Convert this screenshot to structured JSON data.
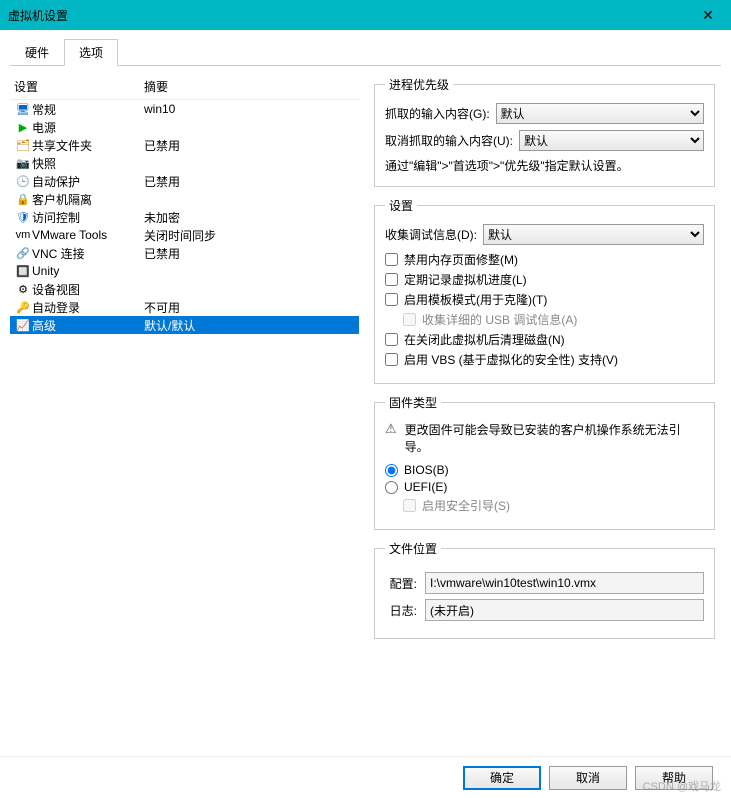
{
  "window": {
    "title": "虚拟机设置",
    "close": "✕"
  },
  "tabs": {
    "hardware": "硬件",
    "options": "选项"
  },
  "list": {
    "header": {
      "col1": "设置",
      "col2": "摘要"
    },
    "items": [
      {
        "icon": "🖥",
        "iconClass": "ico-blue",
        "name": "常规",
        "summary": "win10"
      },
      {
        "icon": "▶",
        "iconClass": "ico-green",
        "name": "电源",
        "summary": ""
      },
      {
        "icon": "🗂",
        "iconClass": "ico-orange",
        "name": "共享文件夹",
        "summary": "已禁用"
      },
      {
        "icon": "📷",
        "iconClass": "",
        "name": "快照",
        "summary": ""
      },
      {
        "icon": "🕒",
        "iconClass": "",
        "name": "自动保护",
        "summary": "已禁用"
      },
      {
        "icon": "🔒",
        "iconClass": "",
        "name": "客户机隔离",
        "summary": ""
      },
      {
        "icon": "🛡",
        "iconClass": "ico-blue",
        "name": "访问控制",
        "summary": "未加密"
      },
      {
        "icon": "vm",
        "iconClass": "",
        "name": "VMware Tools",
        "summary": "关闭时间同步"
      },
      {
        "icon": "🔗",
        "iconClass": "",
        "name": "VNC 连接",
        "summary": "已禁用"
      },
      {
        "icon": "🔲",
        "iconClass": "",
        "name": "Unity",
        "summary": ""
      },
      {
        "icon": "⚙",
        "iconClass": "",
        "name": "设备视图",
        "summary": ""
      },
      {
        "icon": "🔑",
        "iconClass": "",
        "name": "自动登录",
        "summary": "不可用"
      },
      {
        "icon": "📈",
        "iconClass": "ico-blue",
        "name": "高级",
        "summary": "默认/默认"
      }
    ],
    "selectedIndex": 12
  },
  "priority": {
    "legend": "进程优先级",
    "grabbed": "抓取的输入内容(G):",
    "ungrabbed": "取消抓取的输入内容(U):",
    "default": "默认",
    "note": "通过\"编辑\">\"首选项\">\"优先级\"指定默认设置。"
  },
  "settings": {
    "legend": "设置",
    "debug_label": "收集调试信息(D):",
    "debug_default": "默认",
    "chk_mem": "禁用内存页面修整(M)",
    "chk_log": "定期记录虚拟机进度(L)",
    "chk_template": "启用模板模式(用于克隆)(T)",
    "chk_usb": "收集详细的 USB 调试信息(A)",
    "chk_clean": "在关闭此虚拟机后清理磁盘(N)",
    "chk_vbs": "启用 VBS (基于虚拟化的安全性) 支持(V)"
  },
  "firmware": {
    "legend": "固件类型",
    "warning": "更改固件可能会导致已安装的客户机操作系统无法引导。",
    "bios": "BIOS(B)",
    "uefi": "UEFI(E)",
    "secureboot": "启用安全引导(S)"
  },
  "fileloc": {
    "legend": "文件位置",
    "config_label": "配置:",
    "config_value": "I:\\vmware\\win10test\\win10.vmx",
    "log_label": "日志:",
    "log_value": "(未开启)"
  },
  "footer": {
    "ok": "确定",
    "cancel": "取消",
    "help": "帮助"
  },
  "watermark": "CSDN @戏马龙"
}
